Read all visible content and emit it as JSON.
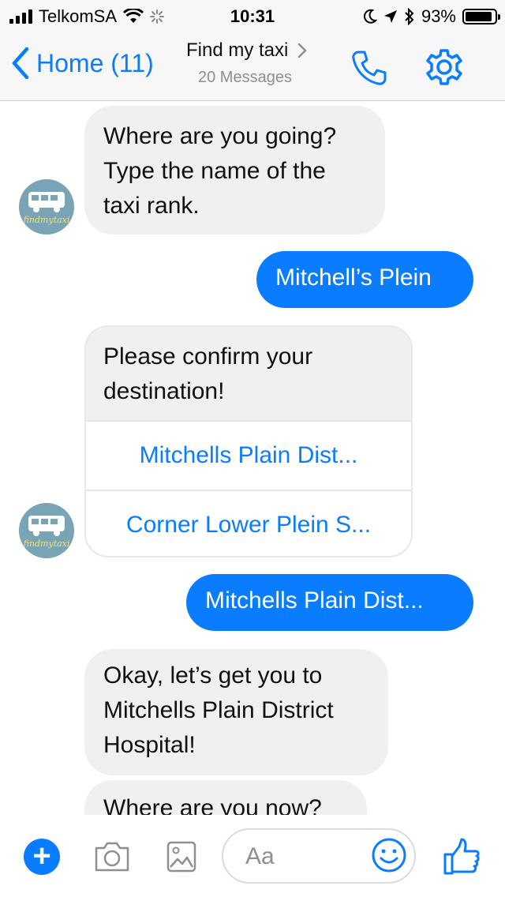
{
  "status_bar": {
    "carrier": "TelkomSA",
    "time": "10:31",
    "battery": "93%",
    "battery_fraction": 0.93
  },
  "nav": {
    "back_label": "Home (11)",
    "title": "Find my taxi",
    "subtitle": "20 Messages",
    "accent": "#0a7cff"
  },
  "messages": {
    "bot_1": [
      "Where are you going?",
      "Type the name of the",
      "taxi rank."
    ],
    "user_1": "Mitchell’s Plein",
    "card": {
      "text": [
        "Please confirm your",
        "destination!"
      ],
      "options": [
        "Mitchells Plain Dist...",
        "Corner Lower Plein S..."
      ]
    },
    "user_2": "Mitchells Plain Dist...",
    "bot_2": [
      "Okay, let’s get you to",
      "Mitchells Plain District",
      "Hospital!"
    ],
    "bot_3": "Where are you now?"
  },
  "avatar": {
    "brand_text": "findmytaxi"
  },
  "composer": {
    "placeholder": "Aa",
    "icons": [
      "plus-icon",
      "camera-icon",
      "gallery-icon",
      "smiley-icon",
      "thumbs-up-icon"
    ]
  }
}
